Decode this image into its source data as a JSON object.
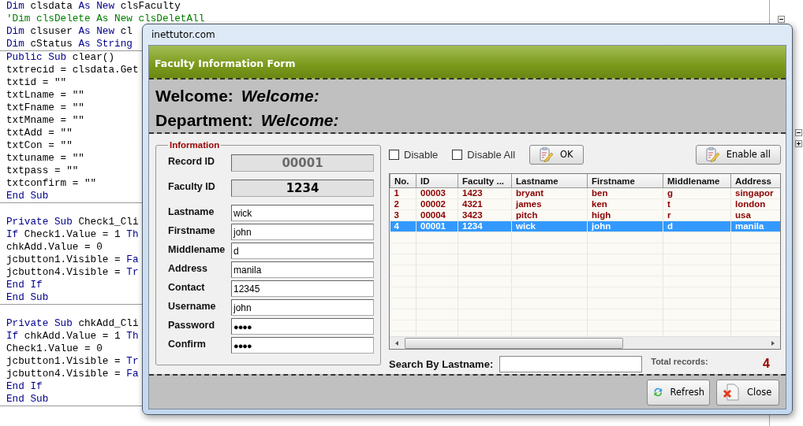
{
  "code_editor": {
    "blocks": [
      {
        "lines": [
          {
            "segments": [
              {
                "text": "Dim ",
                "kind": "keyword"
              },
              {
                "text": "clsdata ",
                "kind": "plain"
              },
              {
                "text": "As New ",
                "kind": "keyword"
              },
              {
                "text": "clsFaculty",
                "kind": "plain"
              }
            ]
          },
          {
            "segments": [
              {
                "text": "'Dim clsDelete As New clsDeletAll",
                "kind": "comment"
              }
            ]
          },
          {
            "segments": [
              {
                "text": "Dim ",
                "kind": "keyword"
              },
              {
                "text": "clsuser ",
                "kind": "plain"
              },
              {
                "text": "As New ",
                "kind": "keyword"
              },
              {
                "text": "cl",
                "kind": "plain"
              }
            ]
          },
          {
            "segments": [
              {
                "text": "Dim ",
                "kind": "keyword"
              },
              {
                "text": "cStatus ",
                "kind": "plain"
              },
              {
                "text": "As String",
                "kind": "keyword"
              }
            ]
          }
        ]
      },
      {
        "lines": [
          {
            "segments": [
              {
                "text": "Public Sub ",
                "kind": "keyword"
              },
              {
                "text": "clear()",
                "kind": "plain"
              }
            ]
          },
          {
            "segments": [
              {
                "text": "txtrecid = clsdata.Get",
                "kind": "plain"
              }
            ]
          },
          {
            "segments": [
              {
                "text": "txtid = \"\"",
                "kind": "plain"
              }
            ]
          },
          {
            "segments": [
              {
                "text": "txtLname = \"\"",
                "kind": "plain"
              }
            ]
          },
          {
            "segments": [
              {
                "text": "txtFname = \"\"",
                "kind": "plain"
              }
            ]
          },
          {
            "segments": [
              {
                "text": "txtMname = \"\"",
                "kind": "plain"
              }
            ]
          },
          {
            "segments": [
              {
                "text": "txtAdd = \"\"",
                "kind": "plain"
              }
            ]
          },
          {
            "segments": [
              {
                "text": "txtCon = \"\"",
                "kind": "plain"
              }
            ]
          },
          {
            "segments": [
              {
                "text": "txtuname = \"\"",
                "kind": "plain"
              }
            ]
          },
          {
            "segments": [
              {
                "text": "txtpass = \"\"",
                "kind": "plain"
              }
            ]
          },
          {
            "segments": [
              {
                "text": "txtconfirm = \"\"",
                "kind": "plain"
              }
            ]
          },
          {
            "segments": [
              {
                "text": "End Sub",
                "kind": "keyword"
              }
            ]
          }
        ]
      },
      {
        "lines": [
          {
            "segments": [
              {
                "text": "Private Sub ",
                "kind": "keyword"
              },
              {
                "text": "Check1_Cli",
                "kind": "plain"
              }
            ]
          },
          {
            "segments": [
              {
                "text": "If ",
                "kind": "keyword"
              },
              {
                "text": "Check1.Value = 1 ",
                "kind": "plain"
              },
              {
                "text": "Th",
                "kind": "keyword"
              }
            ]
          },
          {
            "segments": [
              {
                "text": "chkAdd.Value = 0",
                "kind": "plain"
              }
            ]
          },
          {
            "segments": [
              {
                "text": "jcbutton1.Visible = ",
                "kind": "plain"
              },
              {
                "text": "Fa",
                "kind": "keyword"
              }
            ]
          },
          {
            "segments": [
              {
                "text": "jcbutton4.Visible = ",
                "kind": "plain"
              },
              {
                "text": "Tr",
                "kind": "keyword"
              }
            ]
          },
          {
            "segments": [
              {
                "text": "End If",
                "kind": "keyword"
              }
            ]
          },
          {
            "segments": [
              {
                "text": "End Sub",
                "kind": "keyword"
              }
            ]
          }
        ]
      },
      {
        "lines": [
          {
            "segments": [
              {
                "text": "Private Sub ",
                "kind": "keyword"
              },
              {
                "text": "chkAdd_Cli",
                "kind": "plain"
              }
            ]
          },
          {
            "segments": [
              {
                "text": "If ",
                "kind": "keyword"
              },
              {
                "text": "chkAdd.Value = 1 ",
                "kind": "plain"
              },
              {
                "text": "Th",
                "kind": "keyword"
              }
            ]
          },
          {
            "segments": [
              {
                "text": "Check1.Value = 0",
                "kind": "plain"
              }
            ]
          },
          {
            "segments": [
              {
                "text": "jcbutton1.Visible = ",
                "kind": "plain"
              },
              {
                "text": "Tr",
                "kind": "keyword"
              }
            ]
          },
          {
            "segments": [
              {
                "text": "jcbutton4.Visible = ",
                "kind": "plain"
              },
              {
                "text": "Fa",
                "kind": "keyword"
              }
            ]
          },
          {
            "segments": [
              {
                "text": "End If",
                "kind": "keyword"
              }
            ]
          },
          {
            "segments": [
              {
                "text": "End Sub",
                "kind": "keyword"
              }
            ]
          }
        ]
      }
    ]
  },
  "window": {
    "title": "inettutor.com",
    "header": "Faculty Information Form",
    "welcome": [
      {
        "label": "Welcome:",
        "value": "Welcome:"
      },
      {
        "label": "Department:",
        "value": "Welcome:"
      }
    ],
    "information": {
      "legend": "Information",
      "fields": [
        {
          "label": "Record ID",
          "value": "00001",
          "kind": "locked",
          "disabled": true
        },
        {
          "label": "Faculty ID",
          "value": "1234",
          "kind": "locked",
          "disabled": false
        },
        {
          "label": "Lastname",
          "value": "wick",
          "kind": "text",
          "disabled": false
        },
        {
          "label": "Firstname",
          "value": "john",
          "kind": "text",
          "disabled": false
        },
        {
          "label": "Middlename",
          "value": "d",
          "kind": "text",
          "disabled": false
        },
        {
          "label": "Address",
          "value": "manila",
          "kind": "text",
          "disabled": false
        },
        {
          "label": "Contact",
          "value": "12345",
          "kind": "text",
          "disabled": false
        },
        {
          "label": "Username",
          "value": "john",
          "kind": "text",
          "disabled": false
        },
        {
          "label": "Password",
          "value": "●●●●",
          "kind": "password",
          "disabled": false
        },
        {
          "label": "Confirm",
          "value": "●●●●",
          "kind": "password",
          "disabled": false
        }
      ]
    },
    "checkboxes": [
      {
        "label": "Disable",
        "checked": false
      },
      {
        "label": "Disable All",
        "checked": false
      }
    ],
    "toolbar_buttons": [
      {
        "label": "OK"
      },
      {
        "label": "Enable all"
      }
    ],
    "table": {
      "columns": [
        "No.",
        "ID",
        "Faculty ...",
        "Lastname",
        "Firstname",
        "Middlename",
        "Address"
      ],
      "rows": [
        {
          "cells": [
            "1",
            "00003",
            "1423",
            "bryant",
            "ben",
            "g",
            "singapor"
          ],
          "selected": false
        },
        {
          "cells": [
            "2",
            "00002",
            "4321",
            "james",
            "ken",
            "t",
            "london"
          ],
          "selected": false
        },
        {
          "cells": [
            "3",
            "00004",
            "3423",
            "pitch",
            "high",
            "r",
            "usa"
          ],
          "selected": false
        },
        {
          "cells": [
            "4",
            "00001",
            "1234",
            "wick",
            "john",
            "d",
            "manila"
          ],
          "selected": true
        }
      ]
    },
    "search": {
      "label": "Search By Lastname:"
    },
    "total": {
      "label": "Total records:",
      "value": "4"
    },
    "footer_buttons": [
      {
        "label": "Refresh"
      },
      {
        "label": "Close"
      }
    ]
  }
}
